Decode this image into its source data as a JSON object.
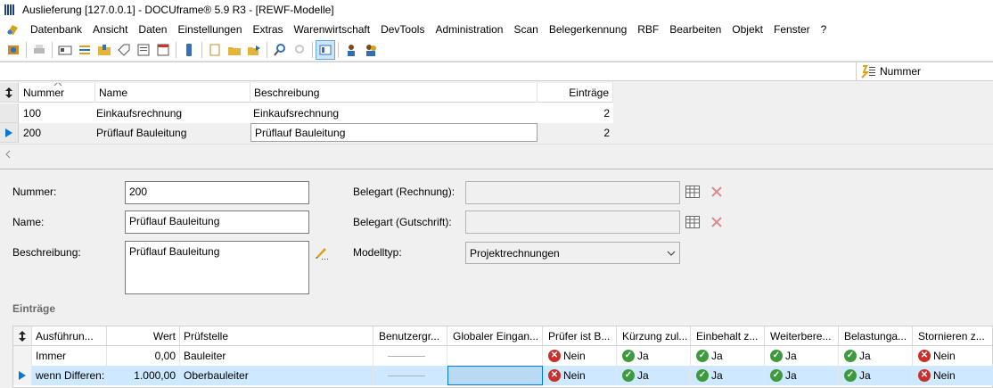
{
  "window": {
    "title": "Auslieferung [127.0.0.1] - DOCUframe® 5.9 R3 - [REWF-Modelle]"
  },
  "menu": [
    "Datenbank",
    "Ansicht",
    "Daten",
    "Einstellungen",
    "Extras",
    "Warenwirtschaft",
    "DevTools",
    "Administration",
    "Scan",
    "Belegerkennung",
    "RBF",
    "Bearbeiten",
    "Objekt",
    "Fenster",
    "?"
  ],
  "sort": {
    "label": "Nummer"
  },
  "models_grid": {
    "headers": [
      "Nummer",
      "Name",
      "Beschreibung",
      "Einträge"
    ],
    "rows": [
      {
        "nummer": "100",
        "name": "Einkaufsrechnung",
        "beschreibung": "Einkaufsrechnung",
        "eintraege": "2"
      },
      {
        "nummer": "200",
        "name": "Prüflauf Bauleitung",
        "beschreibung": "Prüflauf Bauleitung",
        "eintraege": "2"
      }
    ]
  },
  "form": {
    "nummer_label": "Nummer:",
    "nummer_value": "200",
    "name_label": "Name:",
    "name_value": "Prüflauf Bauleitung",
    "beschreibung_label": "Beschreibung:",
    "beschreibung_value": "Prüflauf Bauleitung",
    "belegart_rechnung_label": "Belegart (Rechnung):",
    "belegart_gutschrift_label": "Belegart (Gutschrift):",
    "modelltyp_label": "Modelltyp:",
    "modelltyp_value": "Projektrechnungen"
  },
  "entries": {
    "section_title": "Einträge",
    "headers": [
      "Ausführun...",
      "Wert",
      "Prüfstelle",
      "Benutzergr...",
      "Globaler Eingan...",
      "Prüfer ist B...",
      "Kürzung zul...",
      "Einbehalt z...",
      "Weiterbere...",
      "Belastunga...",
      "Stornieren z..."
    ],
    "rows": [
      {
        "ausfuehrung": "Immer",
        "wert": "0,00",
        "pruefstelle": "Bauleiter",
        "pruefer": "Nein",
        "kuerzung": "Ja",
        "einbehalt": "Ja",
        "weiter": "Ja",
        "belastung": "Ja",
        "stornieren": "Nein"
      },
      {
        "ausfuehrung": "wenn Differen:",
        "wert": "1.000,00",
        "pruefstelle": "Oberbauleiter",
        "pruefer": "Nein",
        "kuerzung": "Ja",
        "einbehalt": "Ja",
        "weiter": "Ja",
        "belastung": "Ja",
        "stornieren": "Nein"
      }
    ]
  },
  "colors": {
    "accent": "#0078d7",
    "selection": "#cde8ff",
    "no": "#c9302c",
    "yes": "#3d9a3d"
  }
}
